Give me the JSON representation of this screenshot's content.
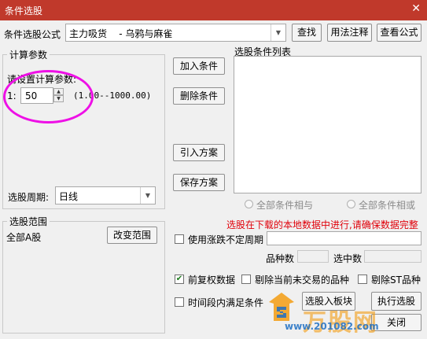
{
  "window": {
    "title": "条件选股",
    "close_glyph": "✕"
  },
  "formula": {
    "label": "条件选股公式",
    "selected": "主力吸货    - 乌鸦与麻雀",
    "find_label": "查找",
    "usage_label": "用法注释",
    "view_label": "查看公式"
  },
  "params": {
    "group_label": "计算参数",
    "prompt": "请设置计算参数:",
    "param_prefix": "1:",
    "value": "50",
    "range": "(1.00--1000.00)"
  },
  "cond_buttons": {
    "add": "加入条件",
    "delete": "删除条件",
    "import": "引入方案",
    "save": "保存方案"
  },
  "cond_list": {
    "label": "选股条件列表"
  },
  "logic": {
    "and": "全部条件相与",
    "or": "全部条件相或"
  },
  "period": {
    "label": "选股周期:",
    "value": "日线"
  },
  "scope": {
    "group_label": "选股范围",
    "value": "全部A股",
    "change_label": "改变范围"
  },
  "notice": "选股在下载的本地数据中进行,请确保数据完整",
  "options": {
    "uncertain_period": {
      "label": "使用涨跌不定周期",
      "checked": false
    },
    "stock_count_label": "品种数",
    "selected_count_label": "选中数",
    "pre_adjust": {
      "label": "前复权数据",
      "checked": true
    },
    "exclude_untraded": {
      "label": "剔除当前未交易的品种",
      "checked": false
    },
    "exclude_st": {
      "label": "剔除ST品种",
      "checked": false
    },
    "time_range": {
      "label": "时间段内满足条件",
      "checked": false
    }
  },
  "actions": {
    "to_block": "选股入板块",
    "execute": "执行选股",
    "close": "关闭"
  },
  "watermark": {
    "brand": "万股网",
    "url": "www.201082.com"
  },
  "colors": {
    "titlebar": "#c0392b",
    "notice": "#e0000a",
    "highlight": "#ee10e6"
  }
}
